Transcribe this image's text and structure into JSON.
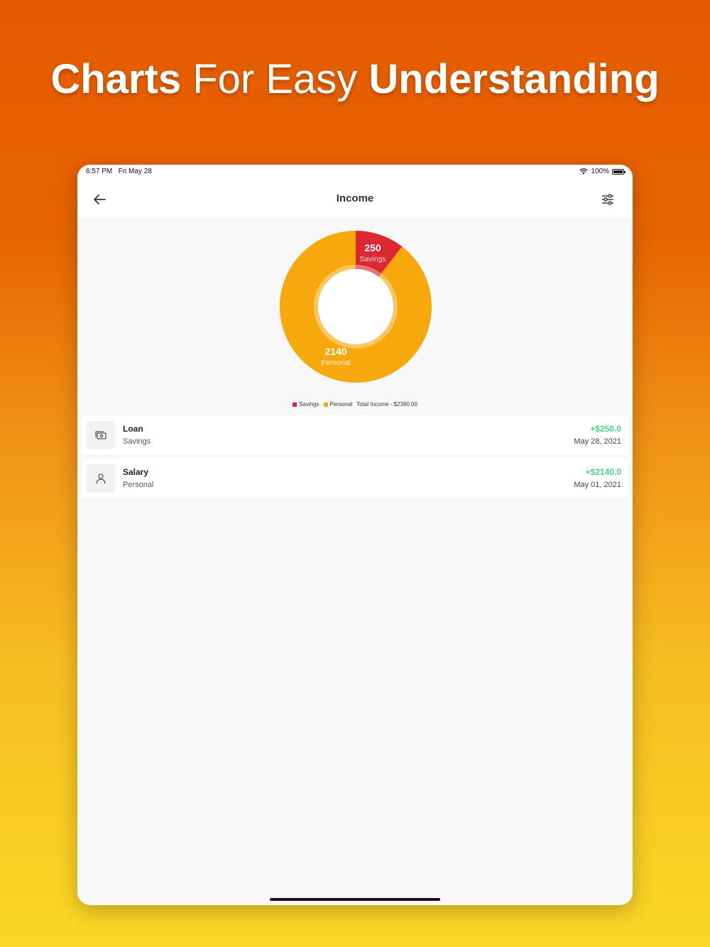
{
  "headline": {
    "part1": "Charts",
    "part2": "For Easy",
    "part3": "Understanding"
  },
  "status_bar": {
    "time": "6:57 PM",
    "date": "Fri May 28",
    "battery": "100%"
  },
  "nav": {
    "title": "Income",
    "back_icon": "arrow-left-icon",
    "filter_icon": "sliders-icon"
  },
  "chart_data": {
    "type": "pie",
    "categories": [
      "Savings",
      "Personal"
    ],
    "values": [
      250,
      2140
    ],
    "colors": [
      "#dd2733",
      "#f7a80d"
    ],
    "donut": true,
    "legend_position": "bottom",
    "total_label": "Total Income - $2390.00"
  },
  "transactions": [
    {
      "title": "Loan",
      "category": "Savings",
      "amount": "+$250.0",
      "date": "May 28, 2021",
      "icon": "cash-icon"
    },
    {
      "title": "Salary",
      "category": "Personal",
      "amount": "+$2140.0",
      "date": "May 01, 2021",
      "icon": "person-icon"
    }
  ],
  "colors": {
    "accent_positive": "#4fcf8a",
    "savings": "#dd2733",
    "personal": "#f7a80d"
  }
}
